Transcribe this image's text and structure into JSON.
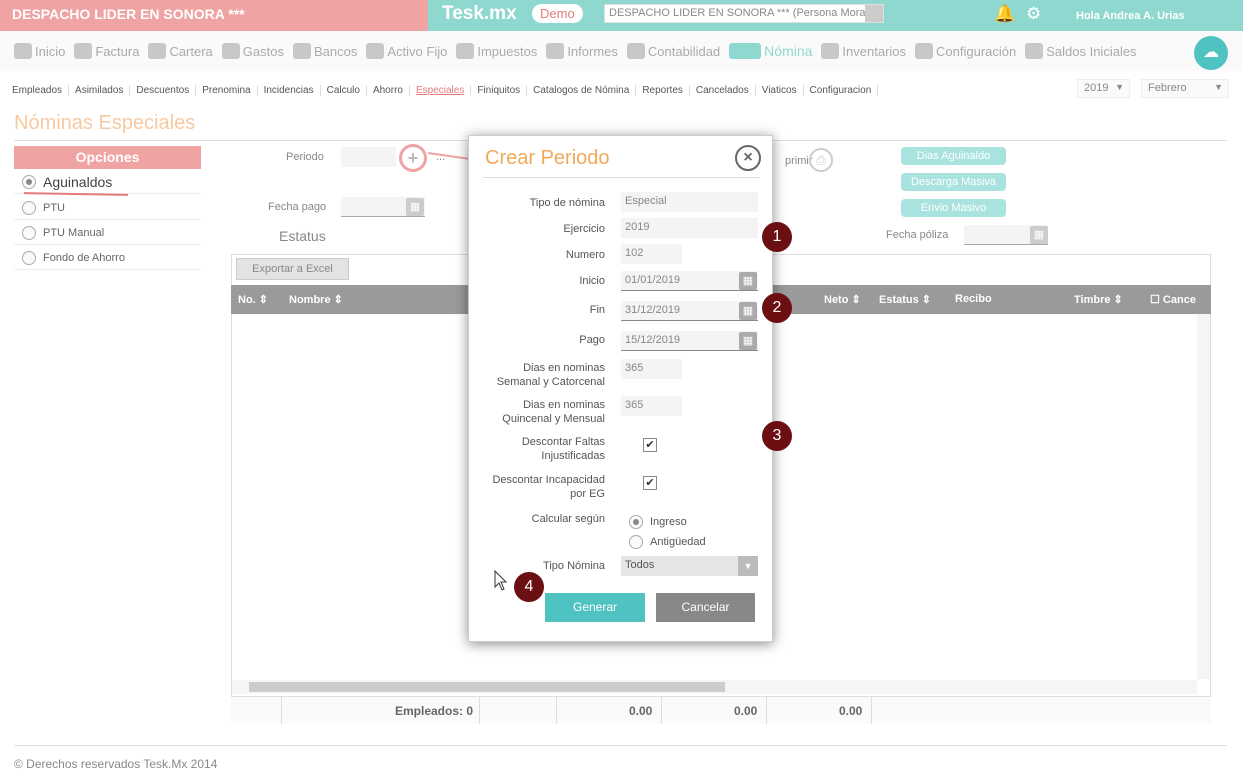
{
  "company": "DESPACHO LIDER EN SONORA ***",
  "brand": "Tesk.mx",
  "demo_badge": "Demo",
  "company_select": "DESPACHO LIDER EN SONORA *** (Persona Mora",
  "greeting": "Hola Andrea A. Urias",
  "main_nav": [
    "Inicio",
    "Factura",
    "Cartera",
    "Gastos",
    "Bancos",
    "Activo Fijo",
    "Impuestos",
    "Informes",
    "Contabilidad",
    "Nómina",
    "Inventarios",
    "Configuración",
    "Saldos Iniciales"
  ],
  "main_nav_active": "Nómina",
  "sub_nav": [
    "Empleados",
    "Asimilados",
    "Descuentos",
    "Prenomina",
    "Incidencias",
    "Calculo",
    "Ahorro",
    "Especiales",
    "Finiquitos",
    "Catalogos de Nómina",
    "Reportes",
    "Cancelados",
    "Viaticos",
    "Configuracion"
  ],
  "sub_nav_active": "Especiales",
  "year": "2019",
  "month": "Febrero",
  "page_title": "Nóminas Especiales",
  "opciones_title": "Opciones",
  "options": [
    "Aguinaldos",
    "PTU",
    "PTU Manual",
    "Fondo de Ahorro"
  ],
  "form": {
    "periodo": "Periodo",
    "dots": "...",
    "fecha_pago": "Fecha pago",
    "estatus": "Estatus",
    "imprimir": "primir",
    "fecha_poliza": "Fecha póliza"
  },
  "action_buttons": [
    "Dias Aguinaldo",
    "Descarga Masiva",
    "Envio Masivo"
  ],
  "export_button": "Exportar a Excel",
  "grid_headers": {
    "no": "No.",
    "nombre": "Nombre",
    "neto": "Neto",
    "estatus": "Estatus",
    "recibo": "Recibo",
    "timbre": "Timbre",
    "cancel": "Cance"
  },
  "grid_footer": {
    "empleados": "Empleados: 0",
    "t1": "0.00",
    "t2": "0.00",
    "t3": "0.00"
  },
  "copyright": "© Derechos reservados Tesk.Mx 2014",
  "modal": {
    "title": "Crear Periodo",
    "tipo_nomina_label": "Tipo de nómina",
    "tipo_nomina": "Especial",
    "ejercicio_label": "Ejercicio",
    "ejercicio": "2019",
    "numero_label": "Numero",
    "numero": "102",
    "inicio_label": "Inicio",
    "inicio": "01/01/2019",
    "fin_label": "Fin",
    "fin": "31/12/2019",
    "pago_label": "Pago",
    "pago": "15/12/2019",
    "dias_sem_label1": "Dias en nominas",
    "dias_sem_label2": "Semanal y Catorcenal",
    "dias_sem": "365",
    "dias_quin_label1": "Dias en nominas",
    "dias_quin_label2": "Quincenal y Mensual",
    "dias_quin": "365",
    "desc_faltas_label1": "Descontar Faltas",
    "desc_faltas_label2": "Injustificadas",
    "desc_faltas": true,
    "desc_incap_label1": "Descontar Incapacidad",
    "desc_incap_label2": "por EG",
    "desc_incap": true,
    "calcular_label": "Calcular según",
    "calc_options": [
      "Ingreso",
      "Antigüedad"
    ],
    "calc_selected": "Ingreso",
    "tipo_nomina2_label": "Tipo Nómina",
    "tipo_nomina2": "Todos",
    "generar": "Generar",
    "cancelar": "Cancelar"
  },
  "steps": [
    "1",
    "2",
    "3",
    "4"
  ],
  "colors": {
    "pink": "#efa3a3",
    "teal": "#8fd8d0",
    "accent": "#4ec3c2",
    "orange": "#f2a85a",
    "step": "#6b0f12"
  }
}
